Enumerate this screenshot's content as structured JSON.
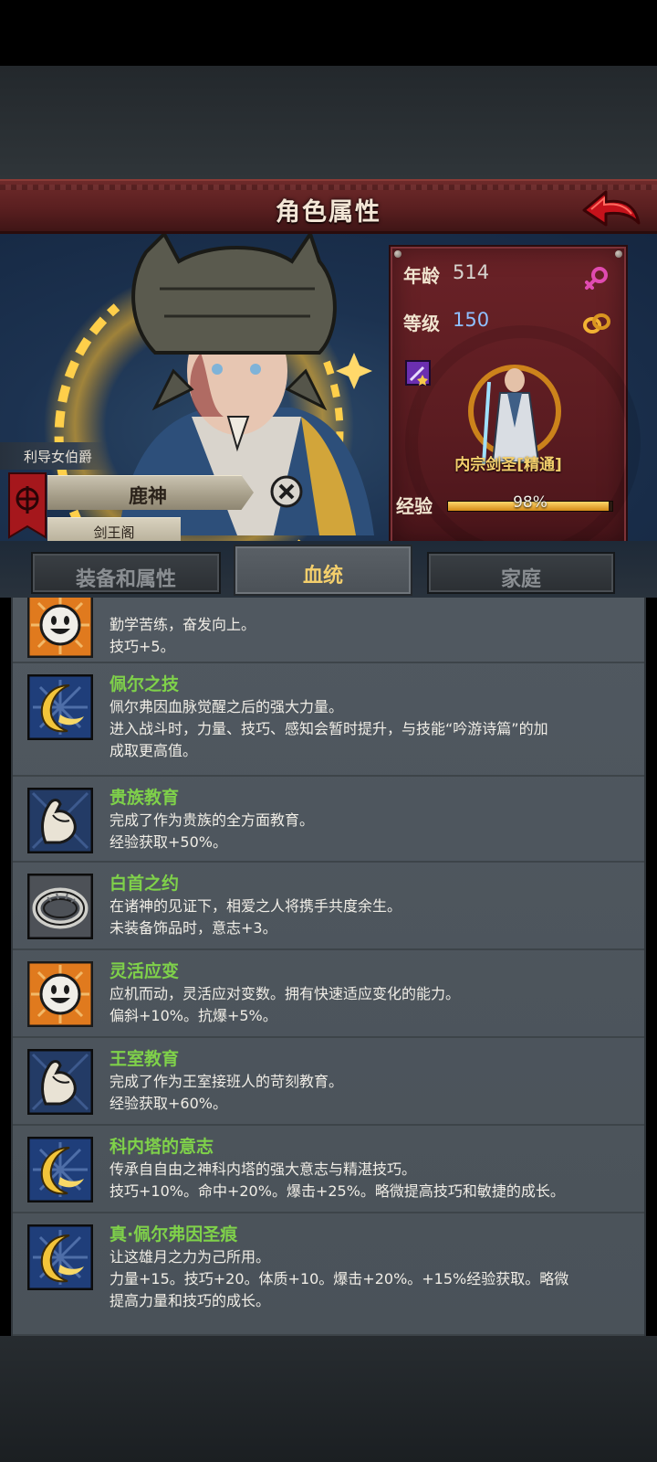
{
  "header": {
    "title": "角色属性",
    "back_icon": "back-arrow-icon"
  },
  "character": {
    "title": "利导女伯爵",
    "name": "鹿神",
    "faction": "剑王阁"
  },
  "info": {
    "age_label": "年龄",
    "age_value": "514",
    "level_label": "等级",
    "level_value": "150",
    "class_name": "内宗剑圣[精通]",
    "exp_label": "经验",
    "exp_text": "98%",
    "exp_progress": 0.98,
    "gender_icon": "female-icon",
    "married_icon": "rings-icon"
  },
  "tabs": [
    {
      "label": "装备和属性"
    },
    {
      "label": "血统"
    },
    {
      "label": "家庭"
    }
  ],
  "traits": [
    {
      "icon": "smiley-icon",
      "title": "",
      "lines": [
        "勤学苦练，奋发向上。",
        "技巧+5。"
      ]
    },
    {
      "icon": "crescent-moon-icon",
      "title": "佩尔之技",
      "lines": [
        "佩尔弗因血脉觉醒之后的强大力量。",
        "进入战斗时，力量、技巧、感知会暂时提升，与技能“吟游诗篇”的加",
        "成取更高值。"
      ]
    },
    {
      "icon": "flexed-arm-icon",
      "title": "贵族教育",
      "lines": [
        "完成了作为贵族的全方面教育。",
        "经验获取+50%。"
      ]
    },
    {
      "icon": "ring-icon",
      "title": "白首之约",
      "lines": [
        "在诸神的见证下，相爱之人将携手共度余生。",
        "未装备饰品时，意志+3。"
      ]
    },
    {
      "icon": "smiley-icon",
      "title": "灵活应变",
      "lines": [
        "应机而动，灵活应对变数。拥有快速适应变化的能力。",
        "偏斜+10%。抗爆+5%。"
      ]
    },
    {
      "icon": "flexed-arm-icon",
      "title": "王室教育",
      "lines": [
        "完成了作为王室接班人的苛刻教育。",
        "经验获取+60%。"
      ]
    },
    {
      "icon": "crescent-moon-icon",
      "title": "科内塔的意志",
      "lines": [
        "传承自自由之神科内塔的强大意志与精湛技巧。",
        "技巧+10%。命中+20%。爆击+25%。略微提高技巧和敏捷的成长。"
      ]
    },
    {
      "icon": "crescent-moon-icon",
      "title": "真·佩尔弗因圣痕",
      "lines": [
        "让这雄月之力为己所用。",
        "力量+15。技巧+20。体质+10。爆击+20%。+15%经验获取。略微",
        "提高力量和技巧的成长。"
      ]
    }
  ]
}
